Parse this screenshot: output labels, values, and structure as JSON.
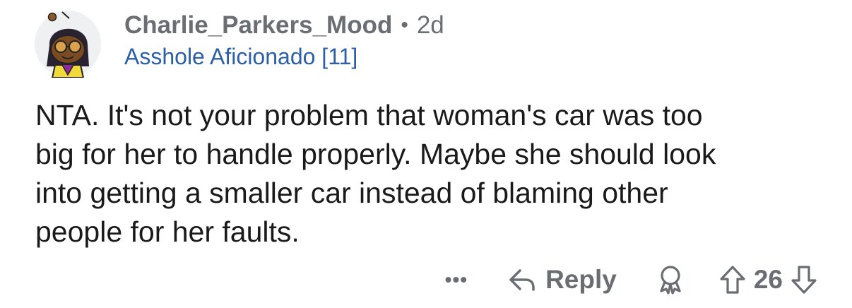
{
  "comment": {
    "username": "Charlie_Parkers_Mood",
    "separator": "•",
    "age": "2d",
    "flair": "Asshole Aficionado [11]",
    "body_lines": [
      "NTA. It's not your problem that woman's car was too",
      "big for her to handle properly. Maybe she should look",
      "into getting a smaller car instead of blaming other",
      "people for her faults."
    ]
  },
  "actions": {
    "more_label": "•••",
    "reply_label": "Reply",
    "score": "26"
  },
  "colors": {
    "meta_gray": "#6a6e73",
    "flair_blue": "#2b5fa8",
    "text": "#1a1a1b"
  },
  "icons": {
    "avatar": "snoo-avatar",
    "reply": "reply-arrow-icon",
    "award": "award-icon",
    "upvote": "upvote-arrow-icon",
    "downvote": "downvote-arrow-icon"
  }
}
